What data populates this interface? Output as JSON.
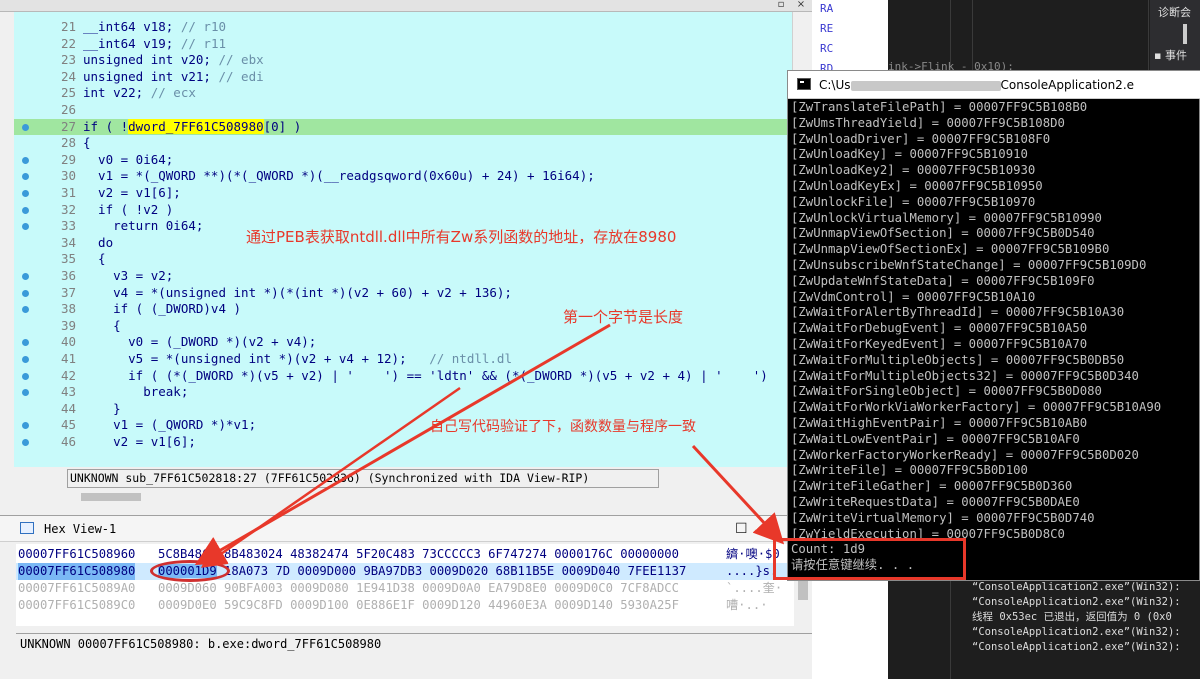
{
  "ida": {
    "code_lines": [
      {
        "n": "21",
        "text": "__int64 v18; ",
        "comment": "// r10",
        "dot": false
      },
      {
        "n": "22",
        "text": "__int64 v19; ",
        "comment": "// r11",
        "dot": false
      },
      {
        "n": "23",
        "text": "unsigned int v20; ",
        "comment": "// ebx",
        "dot": false
      },
      {
        "n": "24",
        "text": "unsigned int v21; ",
        "comment": "// edi",
        "dot": false
      },
      {
        "n": "25",
        "text": "int v22; ",
        "comment": "// ecx",
        "dot": false
      },
      {
        "n": "26",
        "text": "",
        "comment": "",
        "dot": false
      },
      {
        "n": "27",
        "pre": "if ( !",
        "hlname": "dword_7FF61C508980",
        "post": "[0] )",
        "dot": true,
        "highlight": true
      },
      {
        "n": "28",
        "text": "{",
        "comment": "",
        "dot": false
      },
      {
        "n": "29",
        "text": "  v0 = 0i64;",
        "comment": "",
        "dot": true
      },
      {
        "n": "30",
        "text": "  v1 = *(_QWORD **)(*(_QWORD *)(__readgsqword(0x60u) + 24) + 16i64);",
        "comment": "",
        "dot": true
      },
      {
        "n": "31",
        "text": "  v2 = v1[6];",
        "comment": "",
        "dot": true
      },
      {
        "n": "32",
        "text": "  if ( !v2 )",
        "comment": "",
        "dot": true
      },
      {
        "n": "33",
        "text": "    return 0i64;",
        "comment": "",
        "dot": true
      },
      {
        "n": "34",
        "text": "  do",
        "comment": "",
        "dot": false
      },
      {
        "n": "35",
        "text": "  {",
        "comment": "",
        "dot": false
      },
      {
        "n": "36",
        "text": "    v3 = v2;",
        "comment": "",
        "dot": true
      },
      {
        "n": "37",
        "text": "    v4 = *(unsigned int *)(*(int *)(v2 + 60) + v2 + 136);",
        "comment": "",
        "dot": true
      },
      {
        "n": "38",
        "text": "    if ( (_DWORD)v4 )",
        "comment": "",
        "dot": true
      },
      {
        "n": "39",
        "text": "    {",
        "comment": "",
        "dot": false
      },
      {
        "n": "40",
        "text": "      v0 = (_DWORD *)(v2 + v4);",
        "comment": "",
        "dot": true
      },
      {
        "n": "41",
        "text": "      v5 = *(unsigned int *)(v2 + v4 + 12);   ",
        "comment": "// ntdll.dl",
        "dot": true
      },
      {
        "n": "42",
        "text": "      if ( (*(_DWORD *)(v5 + v2) | '    ') == 'ldtn' && (*(_DWORD *)(v5 + v2 + 4) | '    ')",
        "comment": "",
        "dot": true
      },
      {
        "n": "43",
        "text": "        break;",
        "comment": "",
        "dot": true
      },
      {
        "n": "44",
        "text": "    }",
        "comment": "",
        "dot": false
      },
      {
        "n": "45",
        "text": "    v1 = (_QWORD *)*v1;",
        "comment": "",
        "dot": true
      },
      {
        "n": "46",
        "text": "    v2 = v1[6];",
        "comment": "",
        "dot": true
      }
    ],
    "status": "UNKNOWN sub_7FF61C502818:27 (7FF61C502836) (Synchronized with IDA View-RIP)",
    "title_buttons": {
      "restore": "▫",
      "close": "×"
    }
  },
  "hex": {
    "title": "Hex View-1",
    "rows": [
      {
        "addr": "00007FF61C508960",
        "hex": "5C8B48C0 8B483024 48382474 5F20C483 73CCCCC3 6F747274 0000176C 00000000",
        "ascii": "纃·噢·$0",
        "style": "normal"
      },
      {
        "addr": "00007FF61C508980",
        "sel": "000001D9",
        "hex_rest": " 18A073 7D 0009D000 9BA97DB3 0009D020 68B11B5E 0009D040 7FEE1137",
        "ascii": "....}s.",
        "style": "selected"
      },
      {
        "addr": "00007FF61C5089A0",
        "hex": "0009D060 90BFA003 0009D080 1E941D38 0009D0A0 EA79D8E0 0009D0C0 7CF8ADCC",
        "ascii": "`....奎·",
        "style": "gray"
      },
      {
        "addr": "00007FF61C5089C0",
        "hex": "0009D0E0 59C9C8FD 0009D100 0E886E1F 0009D120 44960E3A 0009D140 5930A25F",
        "ascii": "嘈·..·",
        "style": "gray"
      }
    ],
    "status": "UNKNOWN 00007FF61C508980: b.exe:dword_7FF61C508980",
    "buttons": {
      "restore": "☐",
      "close": "×"
    }
  },
  "console": {
    "title_prefix": "C:\\Us",
    "title_suffix": "ConsoleApplication2.e",
    "lines": [
      "[ZwTranslateFilePath] = 00007FF9C5B108B0",
      "[ZwUmsThreadYield] = 00007FF9C5B108D0",
      "[ZwUnloadDriver] = 00007FF9C5B108F0",
      "[ZwUnloadKey] = 00007FF9C5B10910",
      "[ZwUnloadKey2] = 00007FF9C5B10930",
      "[ZwUnloadKeyEx] = 00007FF9C5B10950",
      "[ZwUnlockFile] = 00007FF9C5B10970",
      "[ZwUnlockVirtualMemory] = 00007FF9C5B10990",
      "[ZwUnmapViewOfSection] = 00007FF9C5B0D540",
      "[ZwUnmapViewOfSectionEx] = 00007FF9C5B109B0",
      "[ZwUnsubscribeWnfStateChange] = 00007FF9C5B109D0",
      "[ZwUpdateWnfStateData] = 00007FF9C5B109F0",
      "[ZwVdmControl] = 00007FF9C5B10A10",
      "[ZwWaitForAlertByThreadId] = 00007FF9C5B10A30",
      "[ZwWaitForDebugEvent] = 00007FF9C5B10A50",
      "[ZwWaitForKeyedEvent] = 00007FF9C5B10A70",
      "[ZwWaitForMultipleObjects] = 00007FF9C5B0DB50",
      "[ZwWaitForMultipleObjects32] = 00007FF9C5B0D340",
      "[ZwWaitForSingleObject] = 00007FF9C5B0D080",
      "[ZwWaitForWorkViaWorkerFactory] = 00007FF9C5B10A90",
      "[ZwWaitHighEventPair] = 00007FF9C5B10AB0",
      "[ZwWaitLowEventPair] = 00007FF9C5B10AF0",
      "[ZwWorkerFactoryWorkerReady] = 00007FF9C5B0D020",
      "[ZwWriteFile] = 00007FF9C5B0D100",
      "[ZwWriteFileGather] = 00007FF9C5B0D360",
      "[ZwWriteRequestData] = 00007FF9C5B0DAE0",
      "[ZwWriteVirtualMemory] = 00007FF9C5B0D740",
      "[ZwYieldExecution] = 00007FF9C5B0D8C0",
      "Count: 1d9",
      "请按任意键继续. . ."
    ]
  },
  "vs": {
    "diag_label": "诊断会",
    "events_label": "事件",
    "bg_code": "ink->Flink - 0x10);",
    "strip_labels": [
      "RA",
      "RE",
      "RC",
      "RD"
    ],
    "output_lines": [
      "“ConsoleApplication2.exe”(Win32):",
      "“ConsoleApplication2.exe”(Win32):",
      "线程 0x53ec 已退出，返回值为 0 (0x0",
      "“ConsoleApplication2.exe”(Win32):",
      "“ConsoleApplication2.exe”(Win32):"
    ]
  },
  "annotations": {
    "peb": "通过PEB表获取ntdll.dll中所有Zw系列函数的地址，存放在8980",
    "first_byte": "第一个字节是长度",
    "verify": "自己写代码验证了下，函数数量与程序一致"
  },
  "colors": {
    "code_bg": "#c8fafa",
    "highlight_line": "#a0e6a0",
    "annotation_red": "#e8382a",
    "console_bg": "#000000",
    "console_fg": "#c0c0c0"
  }
}
